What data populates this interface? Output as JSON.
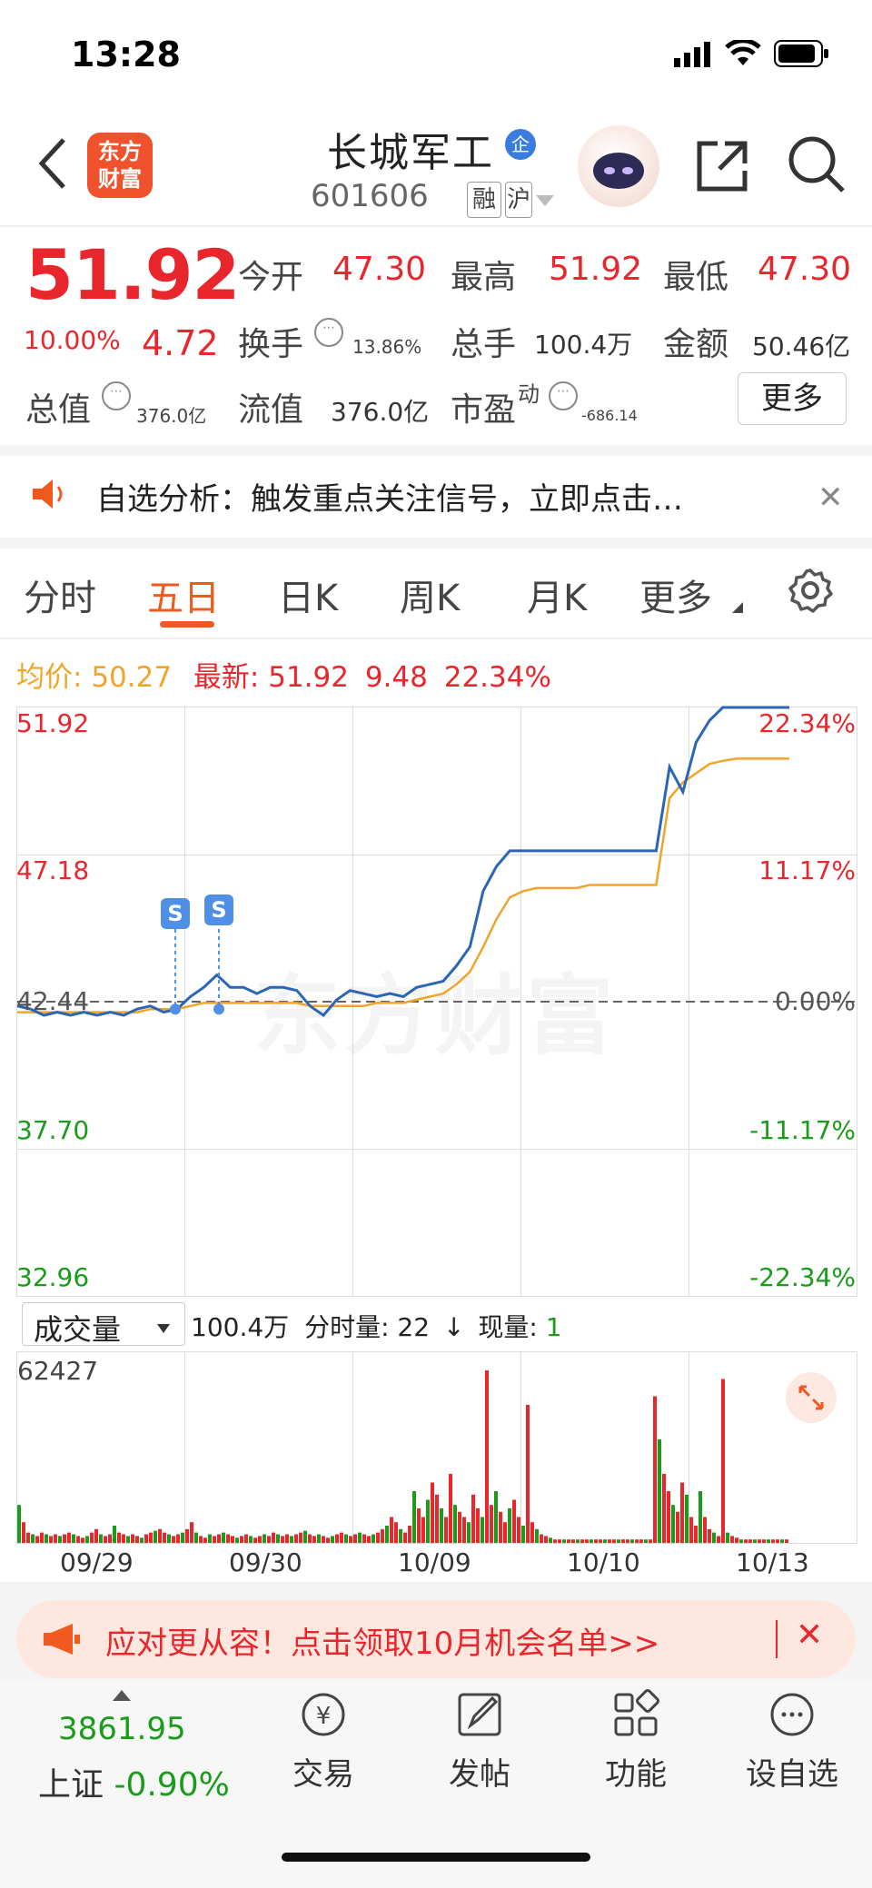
{
  "status_bar": {
    "time": "13:28"
  },
  "header": {
    "logo_line1": "东方",
    "logo_line2": "财富",
    "stock_name": "长城军工",
    "enterprise_badge": "企",
    "stock_code": "601606",
    "tag_margin": "融",
    "tag_market": "沪"
  },
  "quote": {
    "price": "51.92",
    "change_pct": "10.00%",
    "change_amt": "4.72",
    "open_label": "今开",
    "open": "47.30",
    "high_label": "最高",
    "high": "51.92",
    "low_label": "最低",
    "low": "47.30",
    "turnover_label": "换手",
    "turnover": "13.86%",
    "volume_label": "总手",
    "volume": "100.4万",
    "amount_label": "金额",
    "amount": "50.46亿",
    "mktcap_label": "总值",
    "mktcap": "376.0亿",
    "float_label": "流值",
    "float": "376.0亿",
    "pe_label": "市盈",
    "pe_sup": "动",
    "pe": "-686.14",
    "more_button": "更多"
  },
  "alert": {
    "text": "自选分析：触发重点关注信号，立即点击…"
  },
  "tabs": [
    {
      "label": "分时"
    },
    {
      "label": "五日"
    },
    {
      "label": "日K"
    },
    {
      "label": "周K"
    },
    {
      "label": "月K"
    },
    {
      "label": "更多"
    }
  ],
  "chart_info": {
    "avg_label": "均价:",
    "avg": "50.27",
    "latest_label": "最新:",
    "latest": "51.92",
    "diff": "9.48",
    "diff_pct": "22.34%"
  },
  "chart_data": {
    "type": "line",
    "y_left_ticks": [
      "51.92",
      "47.18",
      "42.44",
      "37.70",
      "32.96"
    ],
    "y_right_ticks": [
      "22.34%",
      "11.17%",
      "0.00%",
      "-11.17%",
      "-22.34%"
    ],
    "x_labels": [
      "09/29",
      "09/30",
      "10/09",
      "10/10",
      "10/13"
    ],
    "ylim": [
      32.96,
      51.92
    ],
    "baseline": 42.44,
    "series": [
      {
        "name": "price",
        "color": "#2b65b5",
        "values": [
          42.3,
          42.2,
          42.0,
          42.1,
          42.0,
          42.1,
          42.0,
          42.1,
          42.0,
          42.2,
          42.3,
          42.1,
          42.2,
          42.6,
          42.9,
          43.3,
          42.9,
          42.9,
          42.7,
          42.9,
          42.9,
          42.8,
          42.3,
          42.0,
          42.5,
          42.8,
          42.7,
          42.6,
          42.7,
          42.6,
          42.9,
          43.0,
          43.1,
          43.6,
          44.2,
          46.0,
          46.8,
          47.3,
          47.3,
          47.3,
          47.3,
          47.3,
          47.3,
          47.3,
          47.3,
          47.3,
          47.3,
          47.3,
          47.3,
          50.0,
          49.2,
          50.8,
          51.5,
          51.92,
          51.92,
          51.92,
          51.92,
          51.92,
          51.92
        ]
      },
      {
        "name": "avg",
        "color": "#f0a52a",
        "values": [
          42.1,
          42.1,
          42.1,
          42.1,
          42.1,
          42.1,
          42.1,
          42.1,
          42.1,
          42.1,
          42.2,
          42.2,
          42.2,
          42.3,
          42.4,
          42.4,
          42.4,
          42.4,
          42.4,
          42.4,
          42.4,
          42.4,
          42.3,
          42.3,
          42.3,
          42.3,
          42.3,
          42.4,
          42.4,
          42.4,
          42.5,
          42.6,
          42.7,
          43.0,
          43.4,
          44.2,
          45.1,
          45.8,
          46.0,
          46.1,
          46.1,
          46.1,
          46.1,
          46.2,
          46.2,
          46.2,
          46.2,
          46.2,
          46.2,
          49.0,
          49.5,
          49.8,
          50.1,
          50.2,
          50.27,
          50.27,
          50.27,
          50.27,
          50.27
        ]
      }
    ],
    "signals": [
      "S",
      "S"
    ],
    "watermark": "东方财富"
  },
  "volume": {
    "dropdown_label": "成交量",
    "total": "100.4万",
    "period_label": "分时量:",
    "period_value": "22",
    "arrow": "↓",
    "now_label": "现量:",
    "now_value": "1",
    "max": "62427",
    "bars": [
      0.22,
      0.12,
      0.06,
      0.05,
      0.04,
      0.06,
      0.05,
      0.04,
      0.05,
      0.04,
      0.05,
      0.06,
      0.05,
      0.04,
      0.03,
      0.04,
      0.06,
      0.08,
      0.05,
      0.04,
      0.05,
      0.1,
      0.06,
      0.05,
      0.04,
      0.05,
      0.04,
      0.03,
      0.05,
      0.06,
      0.07,
      0.08,
      0.06,
      0.05,
      0.04,
      0.05,
      0.06,
      0.08,
      0.12,
      0.06,
      0.04,
      0.03,
      0.05,
      0.04,
      0.05,
      0.06,
      0.05,
      0.04,
      0.03,
      0.04,
      0.05,
      0.04,
      0.03,
      0.04,
      0.05,
      0.04,
      0.06,
      0.05,
      0.04,
      0.05,
      0.04,
      0.05,
      0.06,
      0.07,
      0.05,
      0.04,
      0.05,
      0.04,
      0.03,
      0.04,
      0.05,
      0.06,
      0.05,
      0.04,
      0.05,
      0.06,
      0.05,
      0.04,
      0.05,
      0.06,
      0.08,
      0.1,
      0.15,
      0.12,
      0.08,
      0.06,
      0.1,
      0.3,
      0.2,
      0.15,
      0.25,
      0.35,
      0.28,
      0.2,
      0.15,
      0.4,
      0.22,
      0.18,
      0.15,
      0.12,
      0.28,
      0.2,
      0.15,
      1.0,
      0.22,
      0.3,
      0.18,
      0.12,
      0.2,
      0.25,
      0.15,
      0.1,
      0.8,
      0.12,
      0.08,
      0.05,
      0.04,
      0.03,
      0.02,
      0.02,
      0.02,
      0.02,
      0.02,
      0.02,
      0.02,
      0.02,
      0.02,
      0.02,
      0.02,
      0.02,
      0.02,
      0.02,
      0.02,
      0.02,
      0.02,
      0.02,
      0.02,
      0.02,
      0.02,
      0.02,
      0.85,
      0.6,
      0.4,
      0.3,
      0.22,
      0.18,
      0.35,
      0.28,
      0.15,
      0.1,
      0.3,
      0.15,
      0.08,
      0.06,
      0.04,
      0.95,
      0.06,
      0.04,
      0.03,
      0.02,
      0.02,
      0.02,
      0.02,
      0.02,
      0.02,
      0.02,
      0.02,
      0.02,
      0.02,
      0.02
    ]
  },
  "promo": {
    "text": "应对更从容！点击领取10月机会名单>>"
  },
  "bottom_nav": {
    "index_value": "3861.95",
    "index_name": "上证",
    "index_change": "-0.90%",
    "items": [
      {
        "label": "交易",
        "icon": "yen-exchange-icon",
        "glyph": "¥"
      },
      {
        "label": "发帖",
        "icon": "edit-icon",
        "glyph": "✎"
      },
      {
        "label": "功能",
        "icon": "grid-icon",
        "glyph": "▦"
      },
      {
        "label": "设自选",
        "icon": "more-circle-icon",
        "glyph": "⋯"
      }
    ]
  }
}
